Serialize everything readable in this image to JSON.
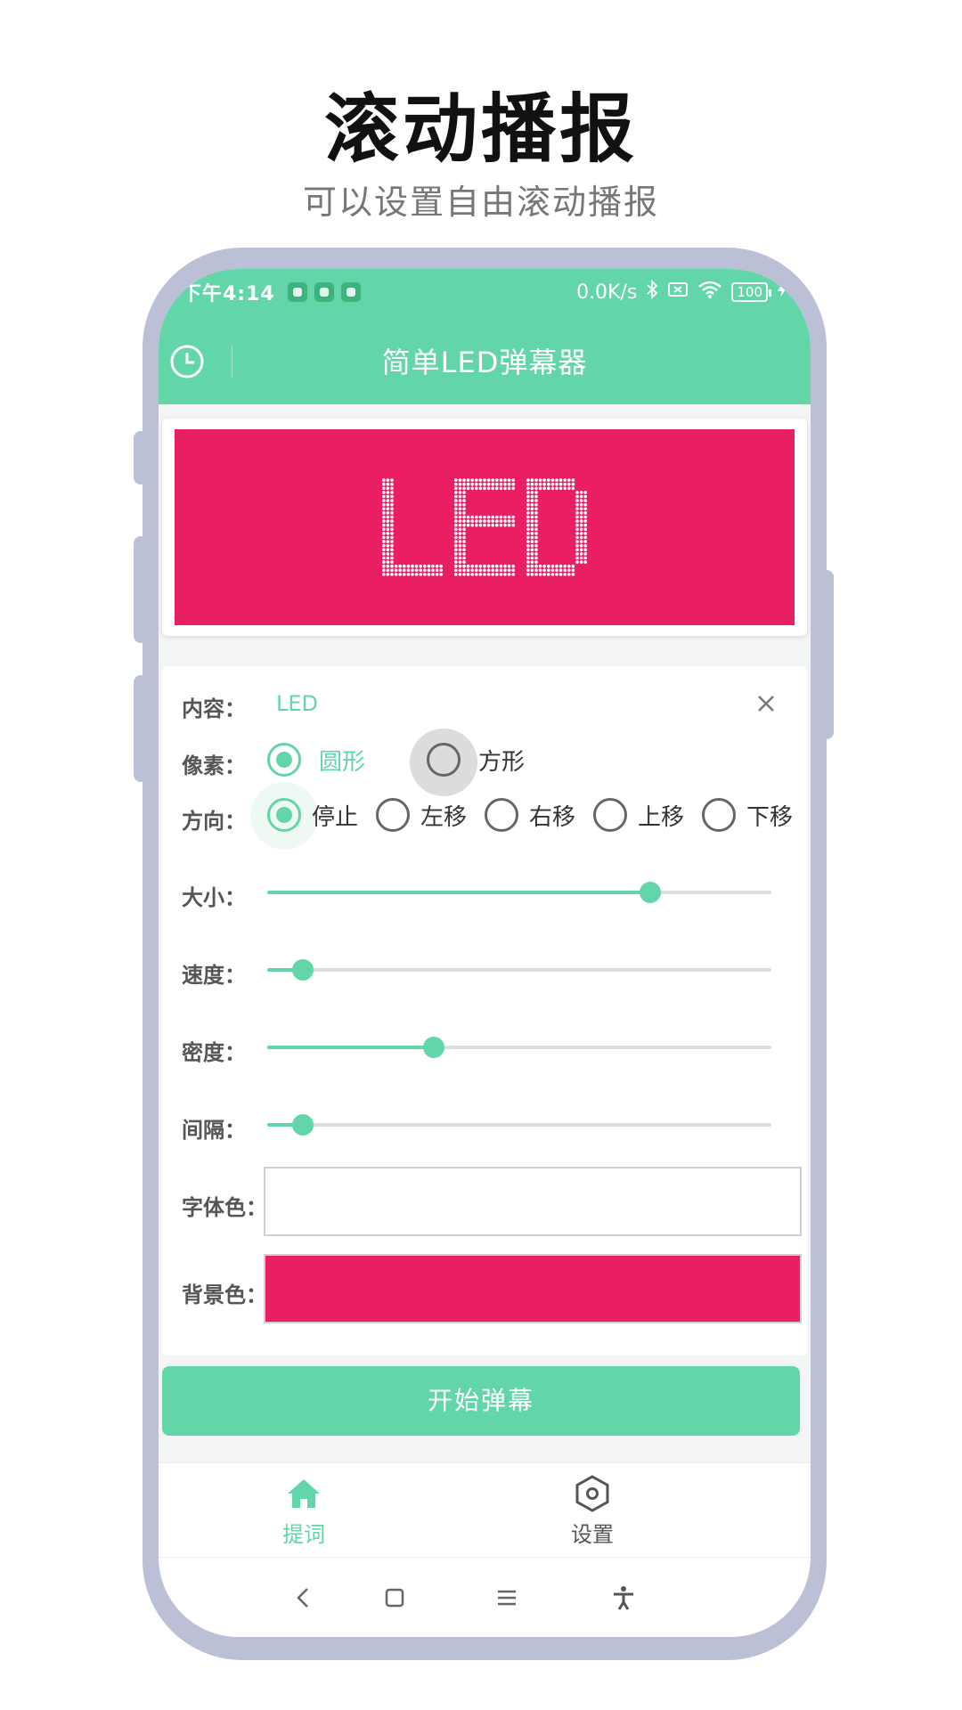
{
  "hero": {
    "title": "滚动播报",
    "subtitle": "可以设置自由滚动播报"
  },
  "status_bar": {
    "time": "下午4:14",
    "speed": "0.0K/s",
    "battery": "100"
  },
  "app_bar": {
    "title": "简单LED弹幕器",
    "history_icon": "clock-icon"
  },
  "preview": {
    "text": "LED",
    "background_color": "#e91e63",
    "dot_color": "#ffffff"
  },
  "form": {
    "content": {
      "label": "内容：",
      "value": "LED",
      "clear_icon": "close-icon"
    },
    "pixel": {
      "label": "像素：",
      "options": [
        "圆形",
        "方形"
      ],
      "selected": "圆形"
    },
    "direction": {
      "label": "方向：",
      "options": [
        "停止",
        "左移",
        "右移",
        "上移",
        "下移"
      ],
      "selected": "停止"
    },
    "size": {
      "label": "大小：",
      "level": 0.76
    },
    "speed": {
      "label": "速度：",
      "level": 0.07
    },
    "density": {
      "label": "密度：",
      "level": 0.33
    },
    "interval": {
      "label": "间隔：",
      "level": 0.07
    },
    "font_color": {
      "label": "字体色：",
      "color": "#ffffff"
    },
    "bg_color": {
      "label": "背景色：",
      "color": "#e91e63"
    }
  },
  "start_button": {
    "label": "开始弹幕"
  },
  "bottom_nav": [
    {
      "label": "提词",
      "icon": "home-icon",
      "active": true
    },
    {
      "label": "设置",
      "icon": "settings-hexagon-icon",
      "active": false
    }
  ],
  "colors": {
    "accent": "#62d6a9",
    "led": "#e91e63",
    "phone_frame": "#bcc0d6"
  }
}
